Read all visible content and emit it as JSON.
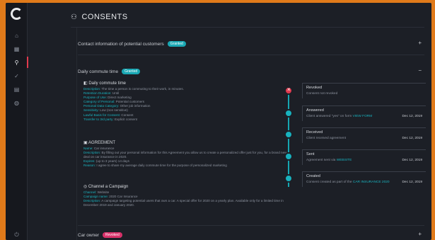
{
  "header": {
    "title": "CONSENTS"
  },
  "sidebar": {
    "items": [
      "home-icon",
      "grid-icon",
      "person-icon",
      "person-check-icon",
      "document-icon",
      "globe-icon"
    ],
    "active_index": 2,
    "logout_icon": "power-icon"
  },
  "panels": [
    {
      "label": "Contact information of potential customers",
      "badge": "Granted",
      "badge_color": "#1aa8b4",
      "toggle": "+"
    },
    {
      "label": "Daily commute time",
      "badge": "Granted",
      "badge_color": "#1aa8b4",
      "toggle": "−"
    },
    {
      "label": "Car owner",
      "badge": "Revoked",
      "badge_color": "#d8326a",
      "toggle": "+"
    }
  ],
  "details": {
    "section1": {
      "title": "Daily commute time",
      "rows": [
        [
          "Description:",
          "The time a person is commuting to their work, in minutes."
        ],
        [
          "Retention Duration:",
          "Until"
        ],
        [
          "Purpose of Use:",
          "Direct marketing"
        ],
        [
          "Category of Personal:",
          "Potential customers"
        ],
        [
          "Personal Data Category:",
          "Other job information"
        ],
        [
          "Sensitivity:",
          "Low (non sensitive)"
        ],
        [
          "Lawful Basis for Consent:",
          "Consent"
        ],
        [
          "Transfer to 3rd party:",
          "Explicit consent"
        ]
      ]
    },
    "section2": {
      "title": "AGREEMENT",
      "rows": [
        [
          "Name:",
          "Car insurance"
        ],
        [
          "Description:",
          "By filling out your personal information for this Agreement you allow us to create a personalized offer just for you, for a brand new deal on car insurance in 2020."
        ],
        [
          "Expires:",
          "(up to 3 years) 14 days"
        ],
        [
          "Reason:",
          "I agree to share my average daily commute time for the purpose of personalized marketing"
        ]
      ]
    },
    "section3": {
      "title": "Channel a Campaign",
      "rows": [
        [
          "Channel:",
          "Website"
        ],
        [
          "Campaign name:",
          "2020 Car Insurance"
        ],
        [
          "Description:",
          "A campaign targeting potential users that own a car. A special offer for 2020 on a yearly plan. Available only for a limited time in December 2019 and January 2020."
        ]
      ]
    }
  },
  "timeline": [
    {
      "title": "Revoked",
      "text": "Consent not revoked",
      "link": "",
      "date": "",
      "color": "#e03a4e"
    },
    {
      "title": "Answered",
      "text": "Client answered \"yes\" on form",
      "link": "VIEW FORM",
      "date": "Dec 12, 2019",
      "color": "#18b2be"
    },
    {
      "title": "Received",
      "text": "Client received agreement",
      "link": "",
      "date": "Dec 12, 2019",
      "color": "#18b2be"
    },
    {
      "title": "Sent",
      "text": "Agreement sent via",
      "link": "WEBSITE",
      "date": "Dec 12, 2019",
      "color": "#18b2be"
    },
    {
      "title": "Created",
      "text": "Consent created as part of the",
      "link": "CAR INSURANCE 2020",
      "date": "Dec 12, 2019",
      "color": "#18b2be"
    }
  ]
}
